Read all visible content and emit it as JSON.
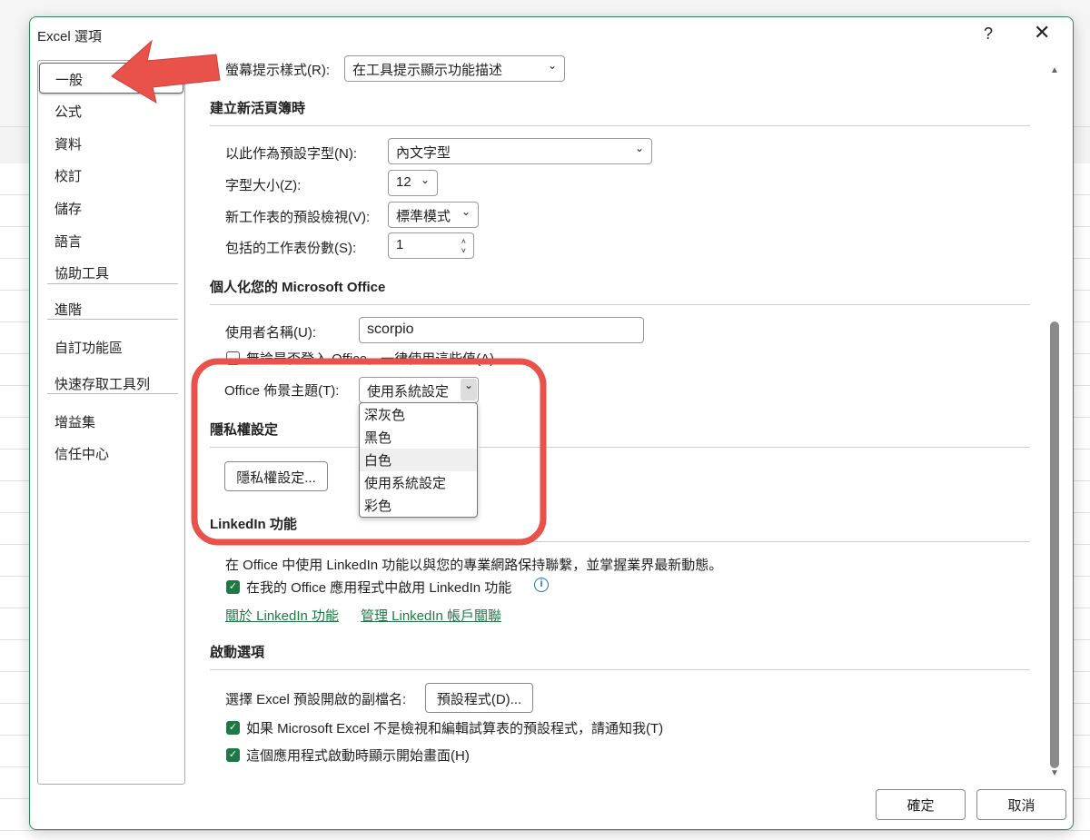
{
  "dialog": {
    "title": "Excel 選項",
    "help": "?",
    "close": "✕"
  },
  "sidebar": {
    "items": [
      "一般",
      "公式",
      "資料",
      "校訂",
      "儲存",
      "語言",
      "協助工具",
      "進階",
      "自訂功能區",
      "快速存取工具列",
      "增益集",
      "信任中心"
    ]
  },
  "ui_options": {
    "screentip_label": "螢幕提示樣式(R):",
    "screentip_value": "在工具提示顯示功能描述"
  },
  "new_workbook": {
    "heading": "建立新活頁簿時",
    "font_label": "以此作為預設字型(N):",
    "font_value": "內文字型",
    "size_label": "字型大小(Z):",
    "size_value": "12",
    "view_label": "新工作表的預設檢視(V):",
    "view_value": "標準模式",
    "sheets_label": "包括的工作表份數(S):",
    "sheets_value": "1"
  },
  "personalize": {
    "heading": "個人化您的 Microsoft Office",
    "username_label": "使用者名稱(U):",
    "username_value": "scorpio",
    "always_use_label": "無論是否登入 Office，一律使用這些值(A)",
    "theme_label": "Office 佈景主題(T):",
    "theme_value": "使用系統設定",
    "theme_options": [
      "深灰色",
      "黑色",
      "白色",
      "使用系統設定",
      "彩色"
    ]
  },
  "privacy": {
    "heading": "隱私權設定",
    "button": "隱私權設定..."
  },
  "linkedin": {
    "heading": "LinkedIn 功能",
    "description": "在 Office 中使用 LinkedIn 功能以與您的專業網路保持聯繫，並掌握業界最新動態。",
    "enable_label": "在我的 Office 應用程式中啟用 LinkedIn 功能",
    "about_link": "關於 LinkedIn 功能",
    "manage_link": "管理 LinkedIn 帳戶關聯"
  },
  "startup": {
    "heading": "啟動選項",
    "ext_label": "選擇 Excel 預設開啟的副檔名:",
    "ext_button": "預設程式(D)...",
    "notify_label": "如果 Microsoft Excel 不是檢視和編輯試算表的預設程式，請通知我(T)",
    "splash_label": "這個應用程式啟動時顯示開始畫面(H)"
  },
  "footer": {
    "ok": "確定",
    "cancel": "取消"
  },
  "colors": {
    "accent": "#1e7a45",
    "annotation": "#e8524a"
  }
}
